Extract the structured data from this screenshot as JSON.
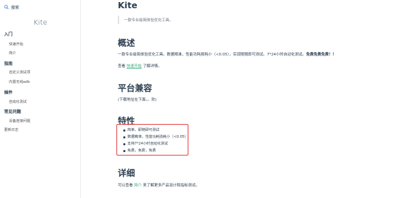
{
  "search": {
    "placeholder": "搜索"
  },
  "sidebar": {
    "brand": "Kite",
    "sections": [
      {
        "title": "入门",
        "items": [
          "快速开始",
          "简介"
        ]
      },
      {
        "title": "指南",
        "items": [
          "自定义测试项",
          "内置无线adb"
        ]
      },
      {
        "title": "插件",
        "items": [
          "自动化测试"
        ]
      },
      {
        "title": "常见问题",
        "items": [
          "设备连接问题"
        ]
      }
    ],
    "changelog": "更新日志"
  },
  "main": {
    "title": "Kite",
    "quote": "一款专业级简体验优化工具。",
    "overview": {
      "heading": "概述",
      "text_a": "一款专业级简体验优化工具。数据精准，性能功耗损耗小（<0.05），实现随随即可测试。7*24小时自动化测试。",
      "text_bold": "免费免费免费！！",
      "see_prefix": "查看 ",
      "see_link": "快速开始",
      "see_suffix": " 了解详情。"
    },
    "compat": {
      "heading": "平台兼容",
      "text": "(下载地址在下面。。欢)"
    },
    "features": {
      "heading": "特性",
      "items": [
        "简单、即随即可测试",
        "数据精准，性能功耗损耗小（<0.05）",
        "支持7*24小时自动化测试",
        "免费，免费，免费"
      ]
    },
    "details": {
      "heading": "详细",
      "prefix": "可以查看 ",
      "link": "简介",
      "suffix": " 来了解更多产品设计和指标测试。"
    }
  },
  "colors": {
    "accent": "#3eaf7c",
    "highlight_border": "#e23b3b",
    "text": "#2c3e50"
  }
}
